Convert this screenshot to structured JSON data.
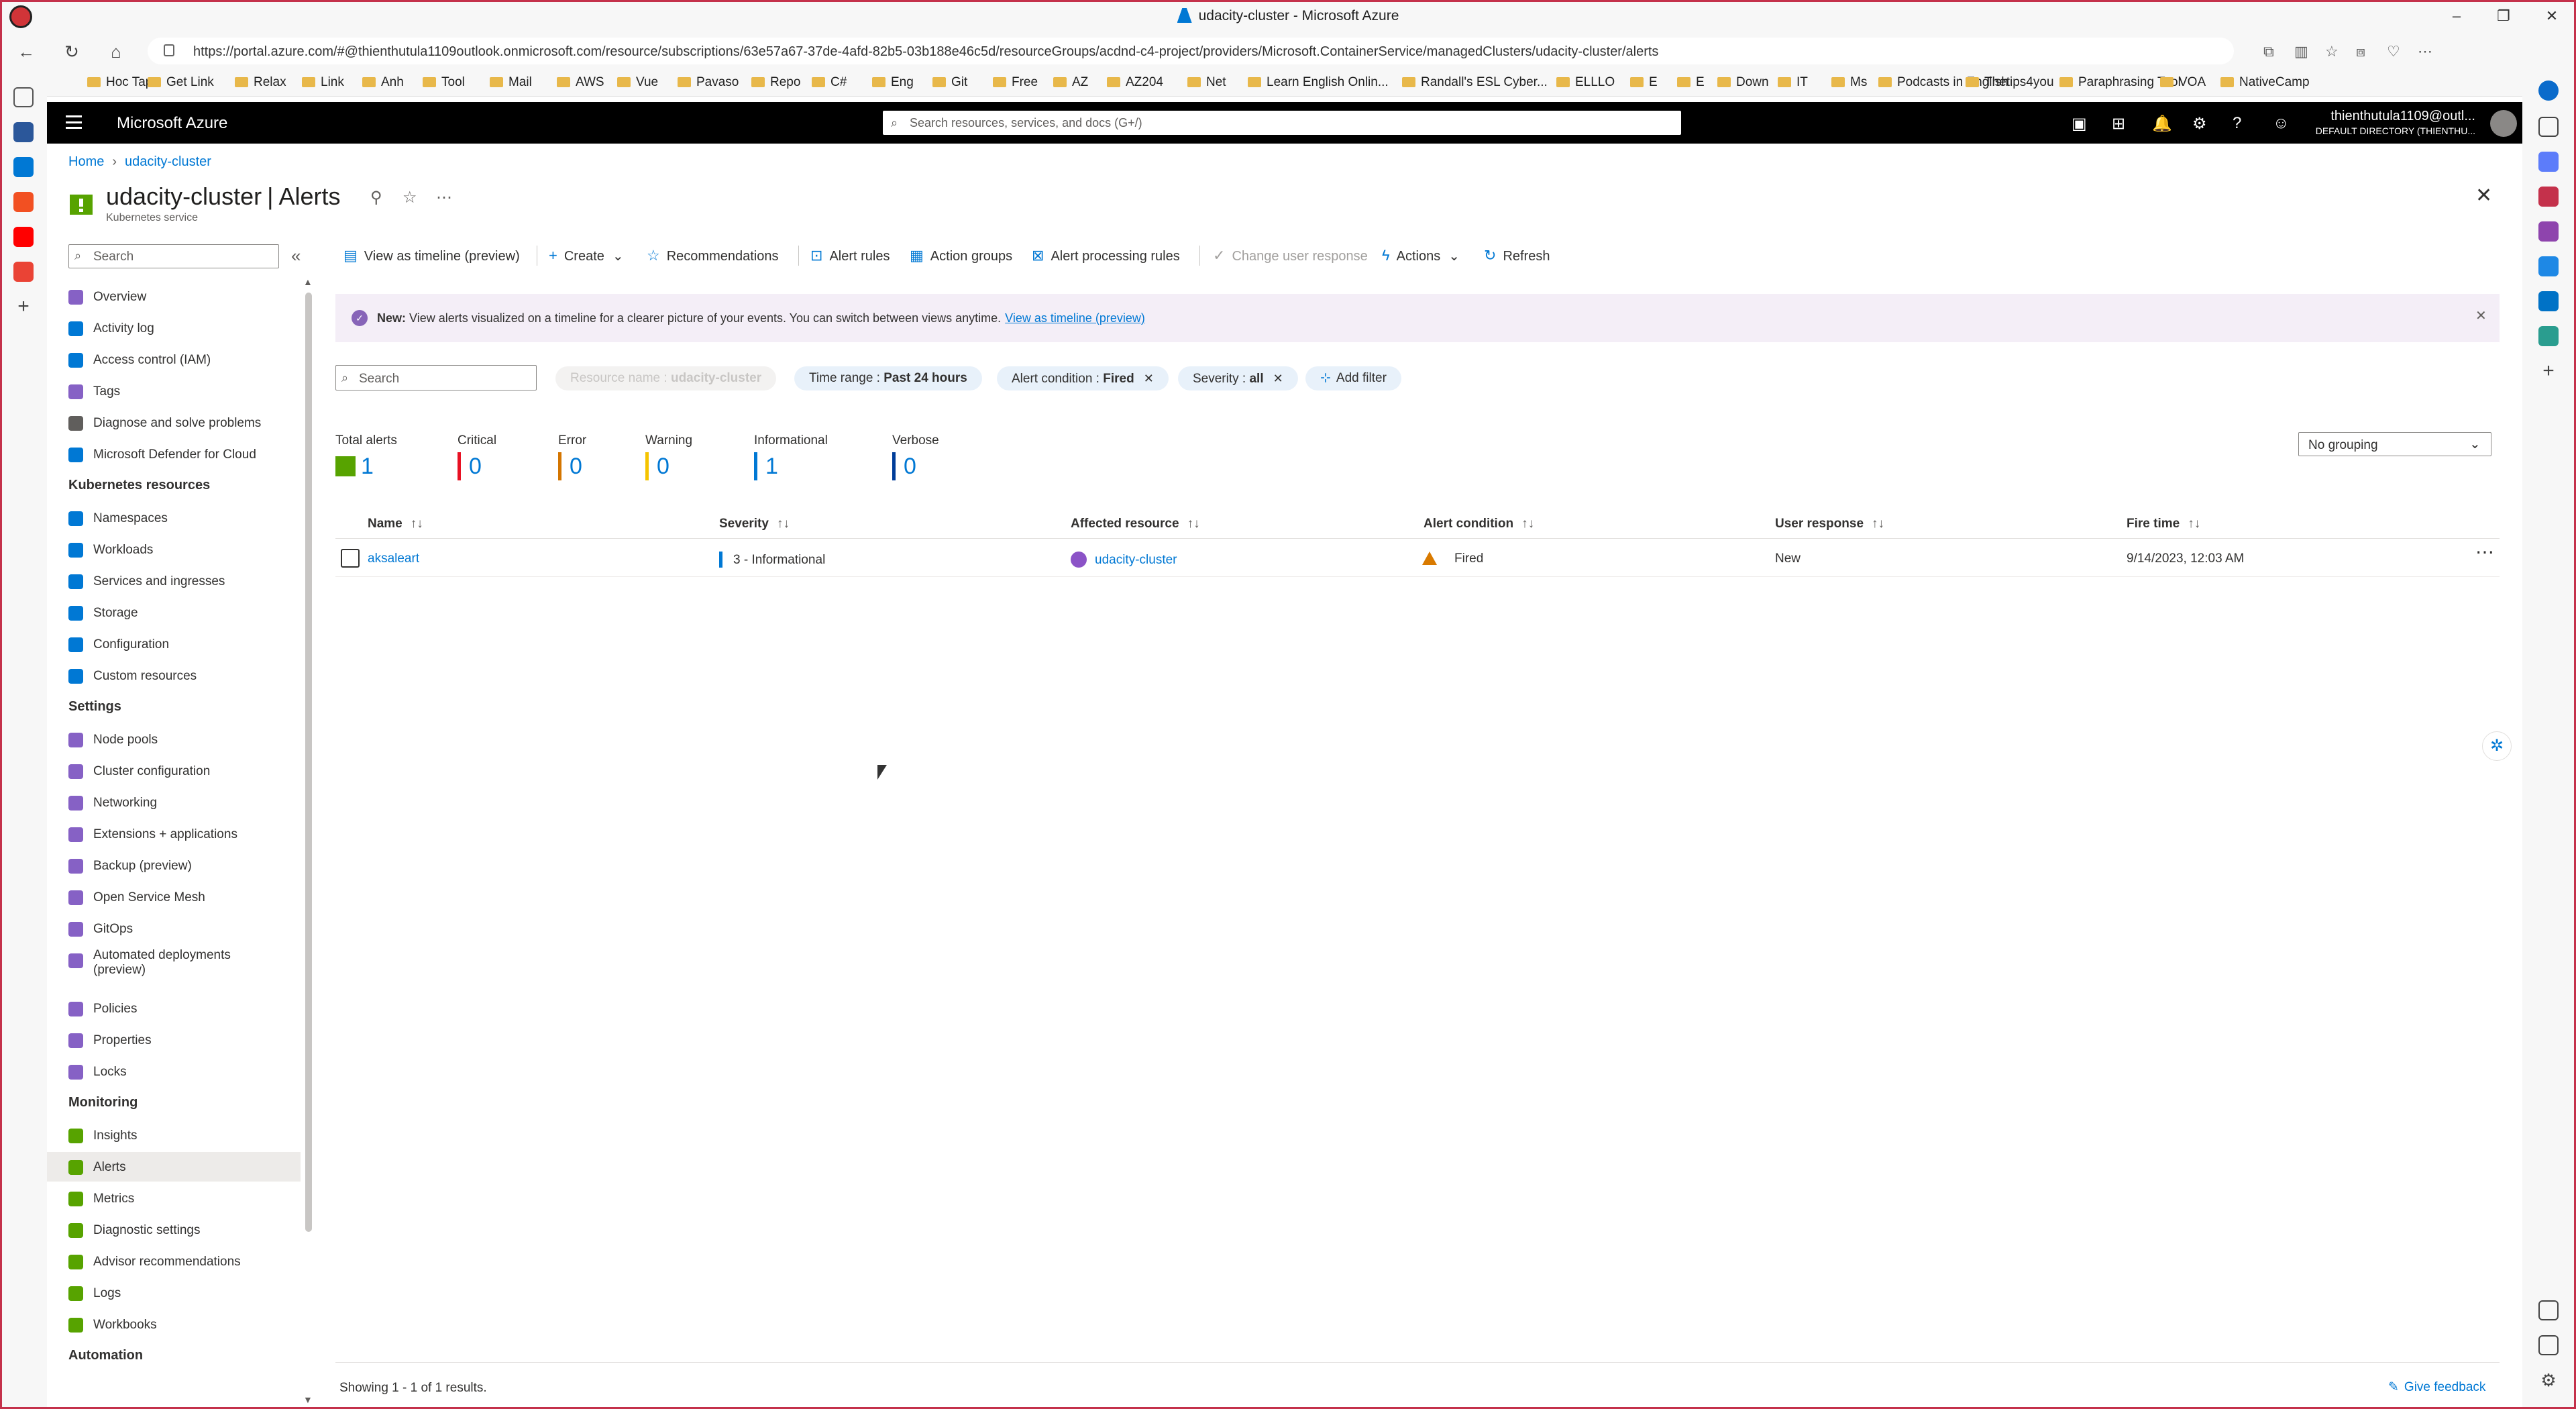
{
  "browser": {
    "window_title": "udacity-cluster - Microsoft Azure",
    "url": "https://portal.azure.com/#@thienthutula1109outlook.onmicrosoft.com/resource/subscriptions/63e57a67-37de-4afd-82b5-03b188e46c5d/resourceGroups/acdnd-c4-project/providers/Microsoft.ContainerService/managedClusters/udacity-cluster/alerts",
    "bookmarks": [
      "Hoc Tap",
      "Get Link",
      "Relax",
      "Link",
      "Anh",
      "Tool",
      "Mail",
      "AWS",
      "Vue",
      "Pavaso",
      "Repo",
      "C#",
      "Eng",
      "Git",
      "Free",
      "AZ",
      "AZ204",
      "Net",
      "Learn English Onlin...",
      "Randall's ESL Cyber...",
      "ELLLO",
      "E",
      "E",
      "Down",
      "IT",
      "Ms",
      "Podcasts in English",
      "Thetips4you",
      "Paraphrasing Tool",
      "VOA",
      "NativeCamp"
    ]
  },
  "azure_header": {
    "brand": "Microsoft Azure",
    "search_placeholder": "Search resources, services, and docs (G+/)",
    "account_name": "thienthutula1109@outl...",
    "account_directory": "DEFAULT DIRECTORY (THIENTHU..."
  },
  "page": {
    "breadcrumb_home": "Home",
    "breadcrumb_resource": "udacity-cluster",
    "resource_name": "udacity-cluster",
    "blade_name": "Alerts",
    "resource_type": "Kubernetes service"
  },
  "nav": {
    "search_placeholder": "Search",
    "top_items": [
      "Overview",
      "Activity log",
      "Access control (IAM)",
      "Tags",
      "Diagnose and solve problems",
      "Microsoft Defender for Cloud"
    ],
    "sections": [
      {
        "title": "Kubernetes resources",
        "items": [
          "Namespaces",
          "Workloads",
          "Services and ingresses",
          "Storage",
          "Configuration",
          "Custom resources"
        ]
      },
      {
        "title": "Settings",
        "items": [
          "Node pools",
          "Cluster configuration",
          "Networking",
          "Extensions + applications",
          "Backup (preview)",
          "Open Service Mesh",
          "GitOps",
          "Automated deployments (preview)",
          "Policies",
          "Properties",
          "Locks"
        ]
      },
      {
        "title": "Monitoring",
        "items": [
          "Insights",
          "Alerts",
          "Metrics",
          "Diagnostic settings",
          "Advisor recommendations",
          "Logs",
          "Workbooks"
        ]
      },
      {
        "title": "Automation",
        "items": []
      }
    ],
    "active_item": "Alerts"
  },
  "toolbar": {
    "view_timeline": "View as timeline (preview)",
    "create": "Create",
    "recommendations": "Recommendations",
    "alert_rules": "Alert rules",
    "action_groups": "Action groups",
    "alert_processing_rules": "Alert processing rules",
    "change_user_response": "Change user response",
    "actions": "Actions",
    "refresh": "Refresh"
  },
  "banner": {
    "prefix": "New:",
    "text": "View alerts visualized on a timeline for a clearer picture of your events. You can switch between views anytime.",
    "link": "View as timeline (preview)"
  },
  "filters": {
    "search_placeholder": "Search",
    "resource_label": "Resource name : ",
    "resource_value": "udacity-cluster",
    "time_label": "Time range : ",
    "time_value": "Past 24 hours",
    "condition_label": "Alert condition : ",
    "condition_value": "Fired",
    "severity_label": "Severity : ",
    "severity_value": "all",
    "add_filter": "Add filter"
  },
  "summary": {
    "total_label": "Total alerts",
    "total": "1",
    "critical_label": "Critical",
    "critical": "0",
    "error_label": "Error",
    "error": "0",
    "warning_label": "Warning",
    "warning": "0",
    "informational_label": "Informational",
    "informational": "1",
    "verbose_label": "Verbose",
    "verbose": "0",
    "grouping": "No grouping",
    "colors": {
      "critical": "#e81123",
      "error": "#d47500",
      "warning": "#f5c400",
      "informational": "#0078d4",
      "verbose": "#003d99"
    }
  },
  "table": {
    "headers": {
      "name": "Name",
      "severity": "Severity",
      "resource": "Affected resource",
      "condition": "Alert condition",
      "response": "User response",
      "fire_time": "Fire time"
    },
    "sort_glyph": "↑↓",
    "rows": [
      {
        "name": "aksaleart",
        "severity": "3 - Informational",
        "resource": "udacity-cluster",
        "condition": "Fired",
        "response": "New",
        "fire_time": "9/14/2023, 12:03 AM"
      }
    ]
  },
  "footer": {
    "showing": "Showing 1 - 1 of 1 results.",
    "feedback": "Give feedback"
  }
}
